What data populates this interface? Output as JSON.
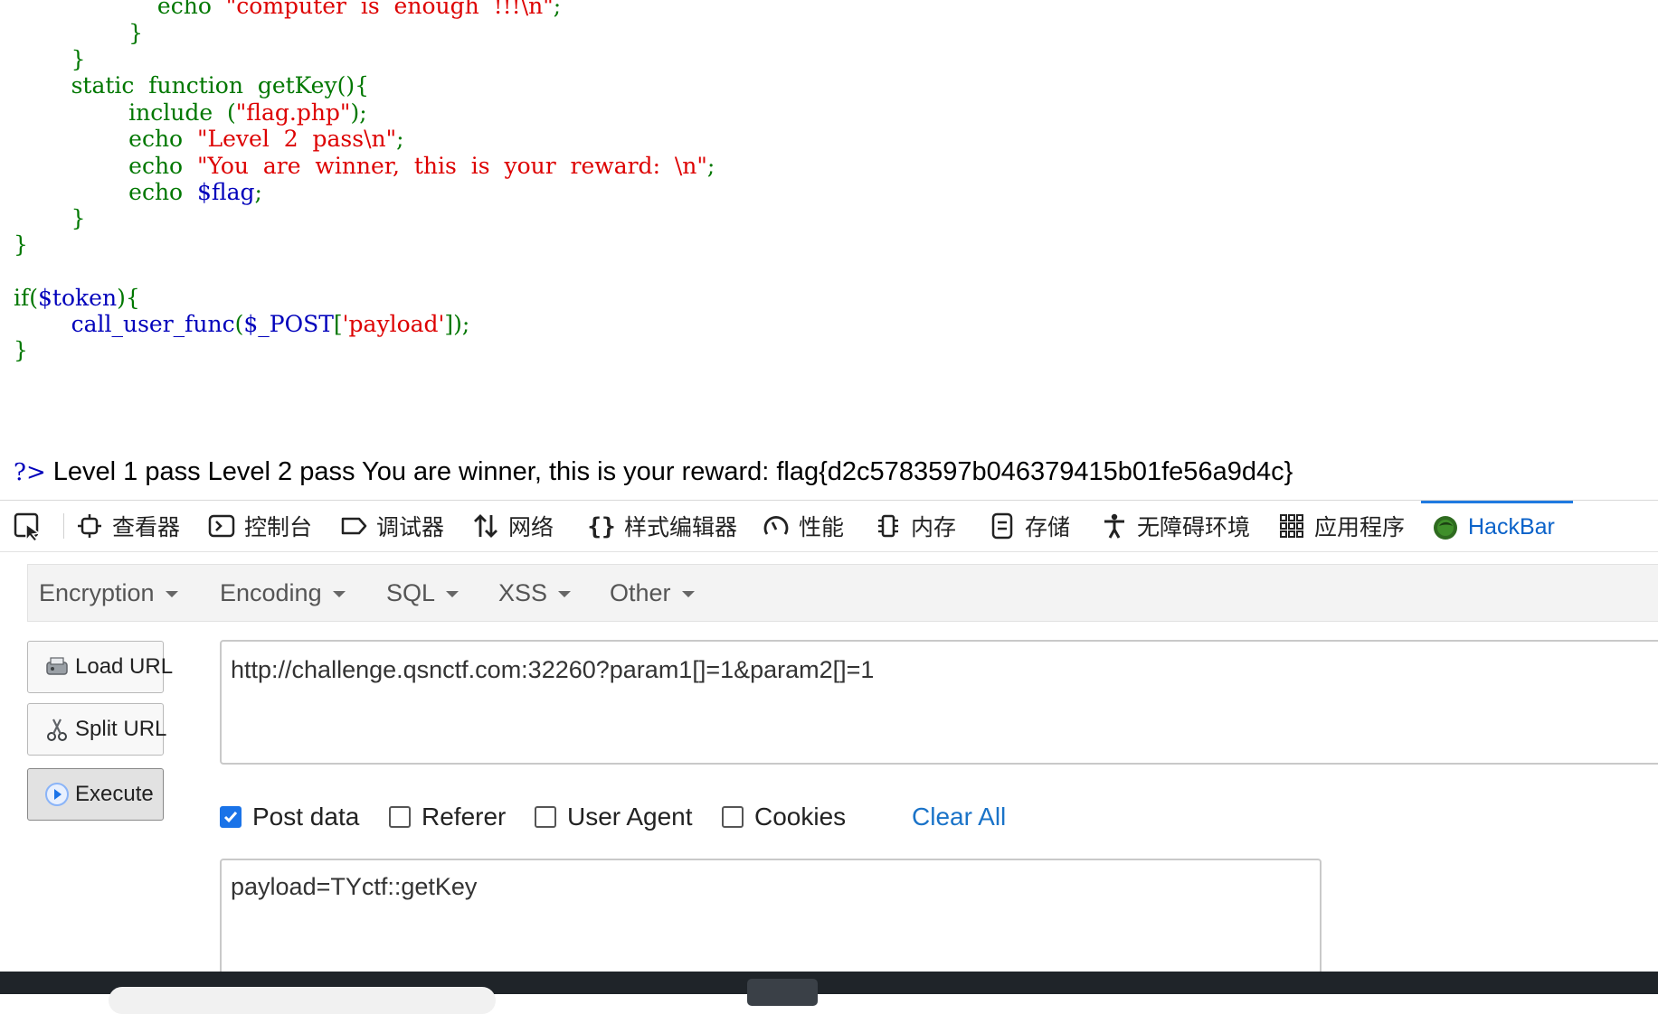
{
  "code_lines": [
    [
      {
        "t": "                    echo  ",
        "c": "k"
      },
      {
        "t": "\"computer  is  enough  !!!\\n\"",
        "c": "s"
      },
      {
        "t": ";",
        "c": "k"
      }
    ],
    [
      {
        "t": "                }",
        "c": "k"
      }
    ],
    [
      {
        "t": "        }",
        "c": "k"
      }
    ],
    [
      {
        "t": "        static  function  getKey(){",
        "c": "k"
      }
    ],
    [
      {
        "t": "                include  (",
        "c": "k"
      },
      {
        "t": "\"flag.php\"",
        "c": "s"
      },
      {
        "t": ");",
        "c": "k"
      }
    ],
    [
      {
        "t": "                echo  ",
        "c": "k"
      },
      {
        "t": "\"Level  2  pass\\n\"",
        "c": "s"
      },
      {
        "t": ";",
        "c": "k"
      }
    ],
    [
      {
        "t": "                echo  ",
        "c": "k"
      },
      {
        "t": "\"You  are  winner,  this  is  your  reward:  \\n\"",
        "c": "s"
      },
      {
        "t": ";",
        "c": "k"
      }
    ],
    [
      {
        "t": "                echo  ",
        "c": "k"
      },
      {
        "t": "$flag",
        "c": "v"
      },
      {
        "t": ";",
        "c": "k"
      }
    ],
    [
      {
        "t": "        }",
        "c": "k"
      }
    ],
    [
      {
        "t": "}",
        "c": "k"
      }
    ],
    [
      {
        "t": "",
        "c": "k"
      }
    ],
    [
      {
        "t": "if(",
        "c": "k"
      },
      {
        "t": "$token",
        "c": "v"
      },
      {
        "t": "){",
        "c": "k"
      }
    ],
    [
      {
        "t": "        ",
        "c": "k"
      },
      {
        "t": "call_user_func",
        "c": "v"
      },
      {
        "t": "(",
        "c": "k"
      },
      {
        "t": "$_POST",
        "c": "v"
      },
      {
        "t": "[",
        "c": "k"
      },
      {
        "t": "'payload'",
        "c": "s"
      },
      {
        "t": "]);",
        "c": "k"
      }
    ],
    [
      {
        "t": "}",
        "c": "k"
      }
    ]
  ],
  "output": {
    "php_close": "?>",
    "text": " Level 1 pass Level 2 pass You are winner, this is your reward: flag{d2c5783597b046379415b01fe56a9d4c}"
  },
  "devtools": {
    "tabs": [
      {
        "id": "inspector",
        "label": "查看器",
        "icon": "inspector-icon"
      },
      {
        "id": "console",
        "label": "控制台",
        "icon": "console-icon"
      },
      {
        "id": "debugger",
        "label": "调试器",
        "icon": "debugger-icon"
      },
      {
        "id": "network",
        "label": "网络",
        "icon": "network-icon"
      },
      {
        "id": "style-editor",
        "label": "样式编辑器",
        "icon": "braces-icon"
      },
      {
        "id": "performance",
        "label": "性能",
        "icon": "gauge-icon"
      },
      {
        "id": "memory",
        "label": "内存",
        "icon": "memory-chip-icon"
      },
      {
        "id": "storage",
        "label": "存储",
        "icon": "storage-icon"
      },
      {
        "id": "accessibility",
        "label": "无障碍环境",
        "icon": "accessibility-icon"
      },
      {
        "id": "application",
        "label": "应用程序",
        "icon": "grid-icon"
      },
      {
        "id": "hackbar",
        "label": "HackBar",
        "icon": "hackbar-logo-icon",
        "active": true
      }
    ]
  },
  "hackbar": {
    "menus": [
      "Encryption",
      "Encoding",
      "SQL",
      "XSS",
      "Other"
    ],
    "buttons": {
      "load_url": "Load URL",
      "split_url": "Split URL",
      "execute": "Execute"
    },
    "url": "http://challenge.qsnctf.com:32260?param1[]=1&param2[]=1",
    "options": {
      "post_data": {
        "label": "Post data",
        "checked": true
      },
      "referer": {
        "label": "Referer",
        "checked": false
      },
      "user_agent": {
        "label": "User Agent",
        "checked": false
      },
      "cookies": {
        "label": "Cookies",
        "checked": false
      }
    },
    "clear_all": "Clear All",
    "post_body": "payload=TYctf::getKey"
  },
  "colors": {
    "php_keyword": "#007700",
    "php_string": "#dd0000",
    "php_variable": "#0000bb",
    "active_tab": "#0a62c9",
    "checkbox_checked": "#1a73e8",
    "clear_all_link": "#1a73c8"
  }
}
